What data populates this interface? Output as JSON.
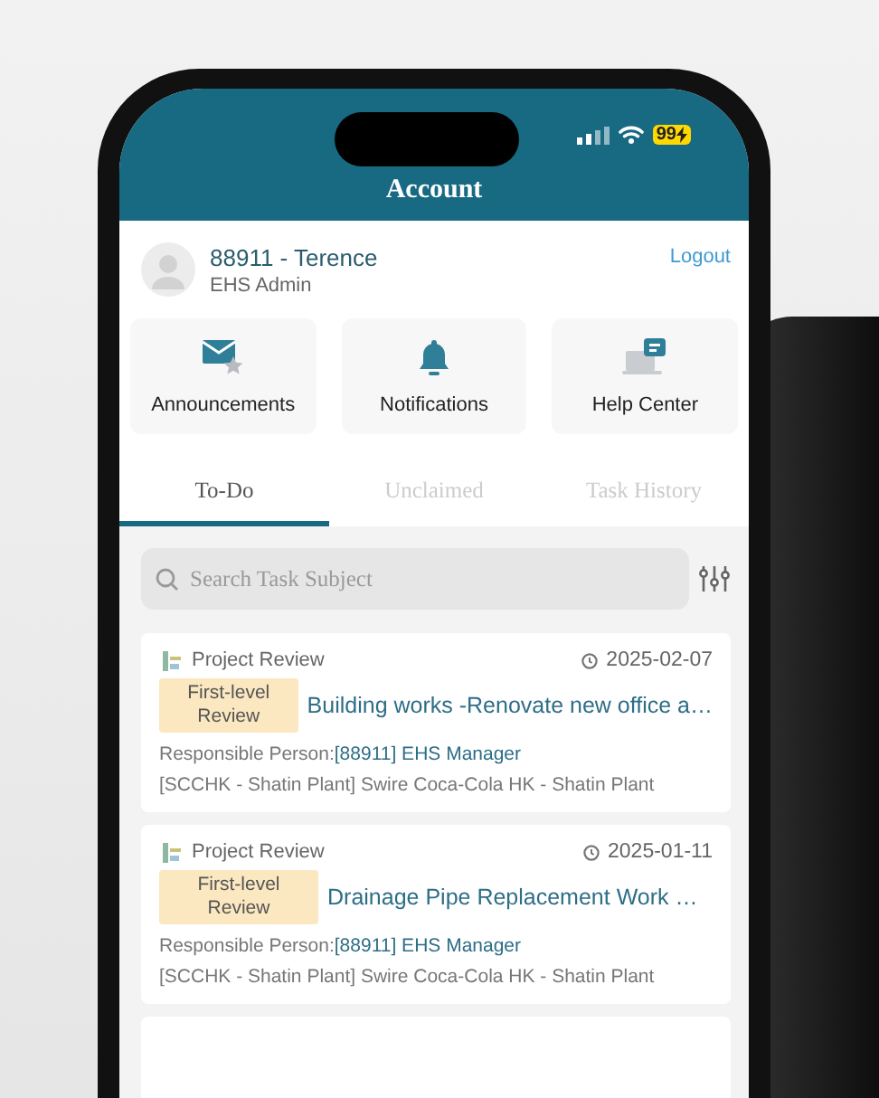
{
  "status_bar": {
    "battery": "99"
  },
  "header": {
    "title": "Account"
  },
  "profile": {
    "name": "88911 - Terence",
    "role": "EHS Admin",
    "logout": "Logout"
  },
  "shortcuts": [
    {
      "kind": "announcements",
      "label": "Announcements"
    },
    {
      "kind": "notifications",
      "label": "Notifications"
    },
    {
      "kind": "help",
      "label": "Help Center"
    }
  ],
  "tabs": [
    {
      "label": "To-Do",
      "selected": true
    },
    {
      "label": "Unclaimed",
      "selected": false
    },
    {
      "label": "Task History",
      "selected": false
    }
  ],
  "search": {
    "placeholder": "Search Task Subject"
  },
  "tasks": [
    {
      "category": "Project Review",
      "date": "2025-02-07",
      "badge": "First-level Review",
      "title": "Building works -Renovate new office a…",
      "person_label": "Responsible Person:",
      "person": "[88911] EHS Manager",
      "location": "[SCCHK - Shatin Plant] Swire Coca-Cola HK - Shatin Plant"
    },
    {
      "category": "Project Review",
      "date": "2025-01-11",
      "badge": "First-level Review",
      "title": "Drainage Pipe Replacement Work …",
      "person_label": "Responsible Person:",
      "person": "[88911] EHS Manager",
      "location": "[SCCHK - Shatin Plant] Swire Coca-Cola HK - Shatin Plant"
    }
  ]
}
